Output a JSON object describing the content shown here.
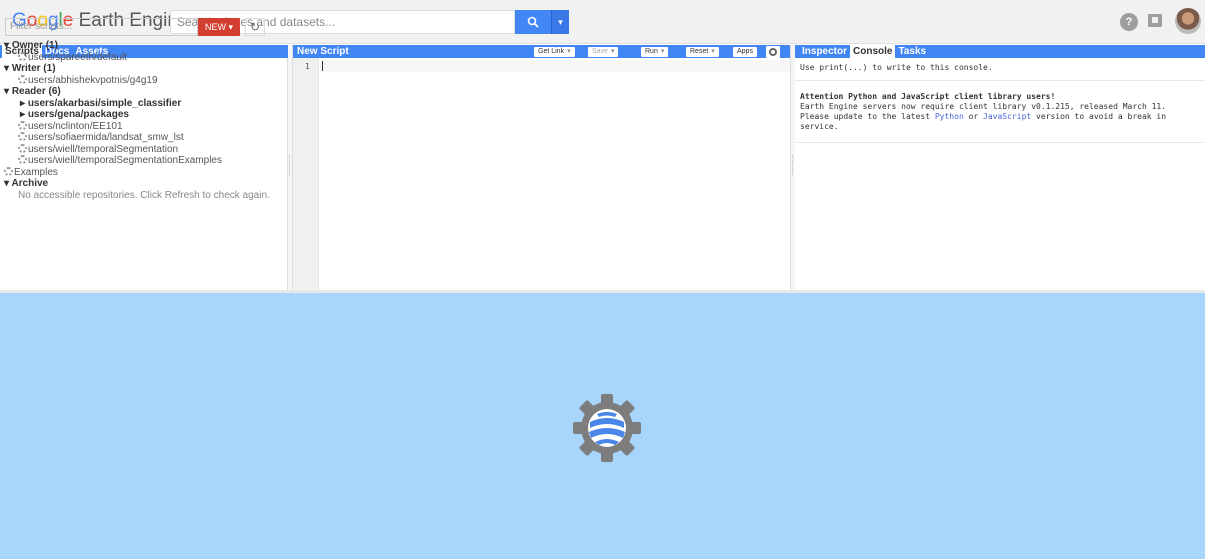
{
  "header": {
    "logo_google": [
      "G",
      "o",
      "o",
      "g",
      "l",
      "e"
    ],
    "logo_rest": " Earth Engine",
    "search_placeholder": "Search places and datasets...",
    "search_icon": "search-icon",
    "search_caret": "▾"
  },
  "left_panel": {
    "tabs": [
      "Scripts",
      "Docs",
      "Assets"
    ],
    "filter_placeholder": "Filter scripts...",
    "new_button": "NEW",
    "tree": {
      "owner_label": "Owner (1)",
      "owner_items": [
        "users/spareeth/default"
      ],
      "writer_label": "Writer (1)",
      "writer_items": [
        "users/abhishekvpotnis/g4g19"
      ],
      "reader_label": "Reader (6)",
      "reader_folders": [
        "users/akarbasi/simple_classifier",
        "users/gena/packages"
      ],
      "reader_items": [
        "users/nclinton/EE101",
        "users/sofiaermida/landsat_smw_lst",
        "users/wiell/temporalSegmentation",
        "users/wiell/temporalSegmentationExamples"
      ],
      "examples_label": "Examples",
      "archive_label": "Archive",
      "archive_message": "No accessible repositories. Click Refresh to check again."
    }
  },
  "editor": {
    "title": "New Script",
    "buttons": {
      "get_link": "Get Link",
      "save": "Save",
      "run": "Run",
      "reset": "Reset",
      "apps": "Apps"
    },
    "line_number": "1"
  },
  "right_panel": {
    "tabs": [
      "Inspector",
      "Console",
      "Tasks"
    ],
    "console_hint": "Use print(...) to write to this console.",
    "notice_title": "Attention Python and JavaScript client library users!",
    "notice_line1": "Earth Engine servers now require client library v0.1.215, released March 11.",
    "notice_line2_pre": "Please update to the latest ",
    "notice_link_python": "Python",
    "notice_line2_mid": " or ",
    "notice_link_js": "JavaScript",
    "notice_line2_post": " version to avoid a break in",
    "notice_line3": "service."
  },
  "colors": {
    "accent": "#4285f4",
    "new_button": "#d23f31",
    "map_background": "#a8d5fb"
  }
}
